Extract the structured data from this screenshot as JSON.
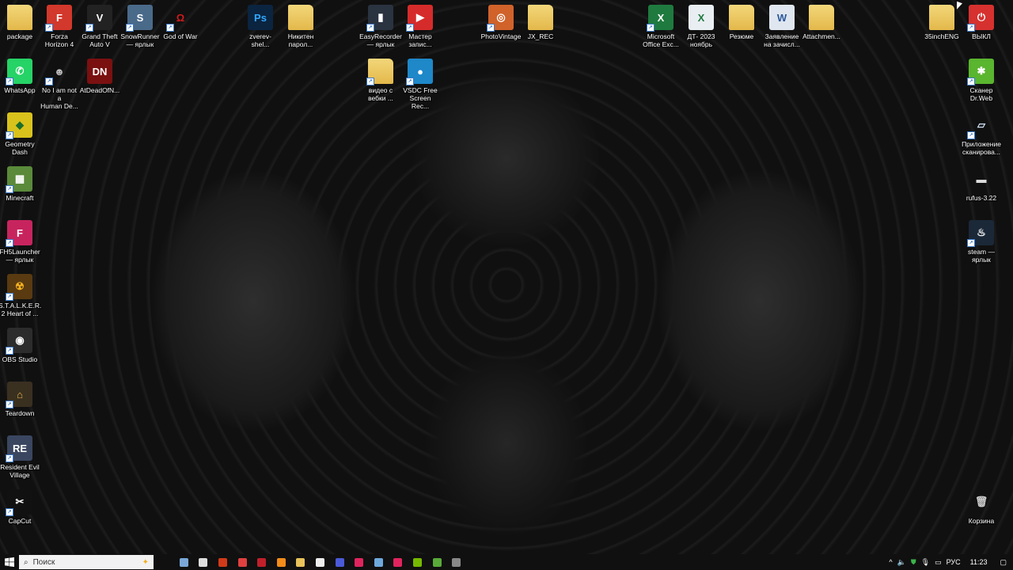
{
  "desktop": {
    "icons": [
      {
        "label": "package",
        "type": "folder",
        "color": "#e8c25a",
        "glyph": ""
      },
      {
        "label": "Forza\nHorizon 4",
        "color": "#d2382b",
        "glyph": "F",
        "shortcut": true
      },
      {
        "label": "Grand Theft\nAuto V",
        "color": "#222",
        "glyph": "V",
        "shortcut": true
      },
      {
        "label": "SnowRunner\n— ярлык",
        "color": "#4a6a8a",
        "glyph": "S",
        "shortcut": true
      },
      {
        "label": "God of War",
        "color": "transparent",
        "glyph": "Ω",
        "fg": "#d01b1b",
        "shortcut": true
      },
      {
        "label": "zverev-shel...",
        "color": "#0b2440",
        "glyph": "Ps",
        "fg": "#31a8ff"
      },
      {
        "label": "Никитен\nпарол...",
        "type": "folder",
        "glyph": ""
      },
      {
        "label": "EasyRecorder\n— ярлык",
        "color": "#2a3340",
        "glyph": "▮",
        "shortcut": true
      },
      {
        "label": "Мастер\nзапис...",
        "color": "#d62b2b",
        "glyph": "▶",
        "shortcut": true
      },
      {
        "label": "PhotoVintage",
        "color": "#d0622a",
        "glyph": "◎",
        "shortcut": true
      },
      {
        "label": "JX_REC",
        "type": "folder",
        "glyph": ""
      },
      {
        "label": "Microsoft\nOffice Exc...",
        "color": "#1f7a3f",
        "glyph": "X",
        "shortcut": true
      },
      {
        "label": "ДТ- 2023\nноябрь",
        "color": "#e9eef3",
        "glyph": "X",
        "fg": "#1f7a3f"
      },
      {
        "label": "Резюме",
        "type": "folder",
        "glyph": ""
      },
      {
        "label": "Заявление\nна зачисл...",
        "color": "#dfe6ef",
        "glyph": "W",
        "fg": "#2b579a"
      },
      {
        "label": "Attachmen...",
        "type": "folder",
        "glyph": ""
      },
      {
        "label": "35inchENG",
        "type": "folder",
        "glyph": ""
      },
      {
        "label": "ВЫКЛ",
        "color": "#d6312f",
        "glyph": "⏻",
        "shortcut": true
      },
      {
        "label": "WhatsApp",
        "color": "#25d366",
        "glyph": "✆",
        "shortcut": true
      },
      {
        "label": "No I am not a\nHuman De...",
        "color": "transparent",
        "glyph": "☻",
        "fg": "#bbb",
        "shortcut": true
      },
      {
        "label": "AtDeadOfN...",
        "color": "#7a1010",
        "glyph": "DN"
      },
      {
        "label": "видео с\nвебки ...",
        "type": "folder",
        "glyph": "",
        "shortcut": true
      },
      {
        "label": "VSDC Free\nScreen Rec...",
        "color": "#1e88c9",
        "glyph": "●",
        "shortcut": true
      },
      {
        "label": "Сканер\nDr.Web",
        "color": "#5ab52f",
        "glyph": "✱",
        "shortcut": true
      },
      {
        "label": "Geometry\nDash",
        "color": "#d9c21c",
        "glyph": "◆",
        "fg": "#1b6d2a",
        "shortcut": true
      },
      {
        "label": "Приложение\nсканирова...",
        "color": "transparent",
        "glyph": "▱",
        "fg": "#cfe3f5",
        "shortcut": true
      },
      {
        "label": "Minecraft",
        "color": "#5a8a3a",
        "glyph": "▦",
        "shortcut": true
      },
      {
        "label": "rufus-3.22",
        "color": "transparent",
        "glyph": "▬",
        "fg": "#ddd"
      },
      {
        "label": "FH5Launcher\n— ярлык",
        "color": "#c7245e",
        "glyph": "F",
        "shortcut": true
      },
      {
        "label": "steam —\nярлык",
        "color": "#1b2838",
        "glyph": "♨",
        "shortcut": true
      },
      {
        "label": "S.T.A.L.K.E.R.\n2 Heart of ...",
        "color": "#5a3a10",
        "glyph": "☢",
        "fg": "#f2b01e",
        "shortcut": true
      },
      {
        "label": "OBS Studio",
        "color": "#2c2c2c",
        "glyph": "◉",
        "shortcut": true
      },
      {
        "label": "Teardown",
        "color": "#3a3020",
        "glyph": "⌂",
        "fg": "#e8b64a",
        "shortcut": true
      },
      {
        "label": "Resident Evil\nVillage",
        "color": "#3a4660",
        "glyph": "RE",
        "shortcut": true
      },
      {
        "label": "CapCut",
        "color": "#111",
        "glyph": "✂",
        "shortcut": true
      },
      {
        "label": "Корзина",
        "color": "transparent",
        "glyph": "🗑",
        "fg": "#ccc"
      }
    ]
  },
  "taskbar": {
    "search_placeholder": "Поиск",
    "apps": [
      {
        "name": "user-app",
        "color": "#7aa7d8"
      },
      {
        "name": "task-view",
        "color": "#ddd"
      },
      {
        "name": "game-app",
        "color": "#d03a1a"
      },
      {
        "name": "yandex-browser",
        "color": "#e04040"
      },
      {
        "name": "aida64",
        "color": "#c0202a"
      },
      {
        "name": "firefox",
        "color": "#f28c1a"
      },
      {
        "name": "file-explorer",
        "color": "#e8c25a"
      },
      {
        "name": "settings",
        "color": "#eee"
      },
      {
        "name": "zona",
        "color": "#4a5ad8"
      },
      {
        "name": "ivi",
        "color": "#e0245e"
      },
      {
        "name": "notepad",
        "color": "#6fa8dc"
      },
      {
        "name": "red-app",
        "color": "#e0245e"
      },
      {
        "name": "nvidia",
        "color": "#76b900"
      },
      {
        "name": "utorrent",
        "color": "#5aaa3a"
      },
      {
        "name": "steam-client",
        "color": "#888"
      }
    ],
    "tray": {
      "chevron": "^",
      "language": "РУС",
      "time": "11:23"
    }
  }
}
